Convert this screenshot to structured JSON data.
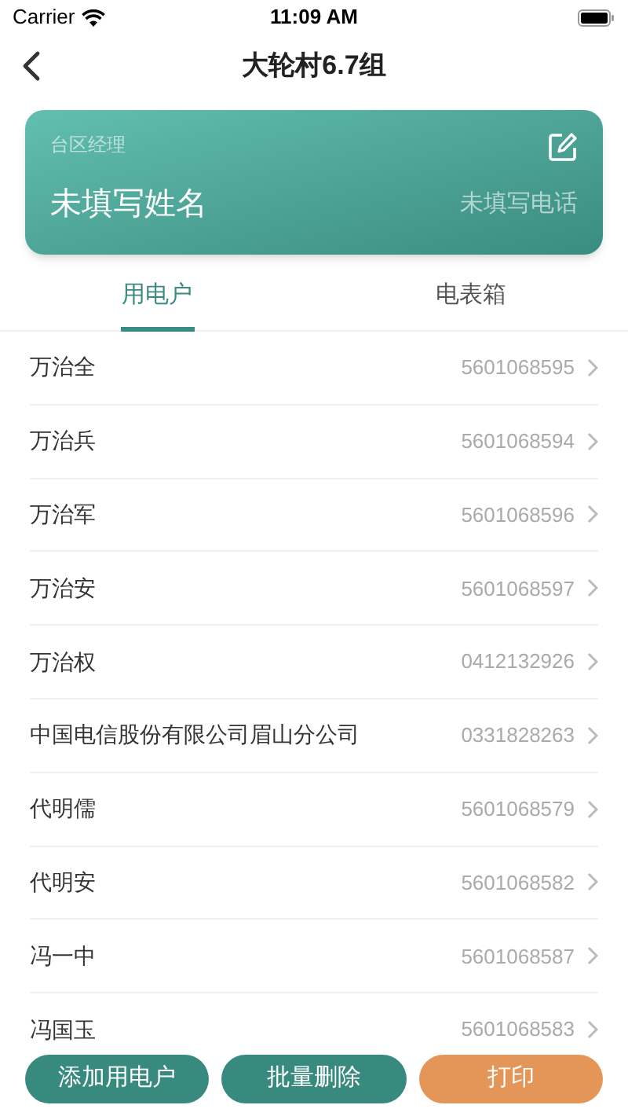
{
  "status_bar": {
    "carrier": "Carrier",
    "time": "11:09 AM"
  },
  "nav": {
    "title": "大轮村6.7组"
  },
  "manager_card": {
    "label": "台区经理",
    "name": "未填写姓名",
    "phone": "未填写电话"
  },
  "tabs": [
    {
      "label": "用电户",
      "selected": true
    },
    {
      "label": "电表箱",
      "selected": false
    }
  ],
  "customers": [
    {
      "name": "万治全",
      "number": "5601068595"
    },
    {
      "name": "万治兵",
      "number": "5601068594"
    },
    {
      "name": "万治军",
      "number": "5601068596"
    },
    {
      "name": "万治安",
      "number": "5601068597"
    },
    {
      "name": "万治权",
      "number": "0412132926"
    },
    {
      "name": "中国电信股份有限公司眉山分公司",
      "number": "0331828263"
    },
    {
      "name": "代明儒",
      "number": "5601068579"
    },
    {
      "name": "代明安",
      "number": "5601068582"
    },
    {
      "name": "冯一中",
      "number": "5601068587"
    },
    {
      "name": "冯国玉",
      "number": "5601068583"
    }
  ],
  "buttons": [
    {
      "label": "添加用电户",
      "kind": "primary"
    },
    {
      "label": "批量删除",
      "kind": "primary"
    },
    {
      "label": "打印",
      "kind": "accent"
    }
  ]
}
